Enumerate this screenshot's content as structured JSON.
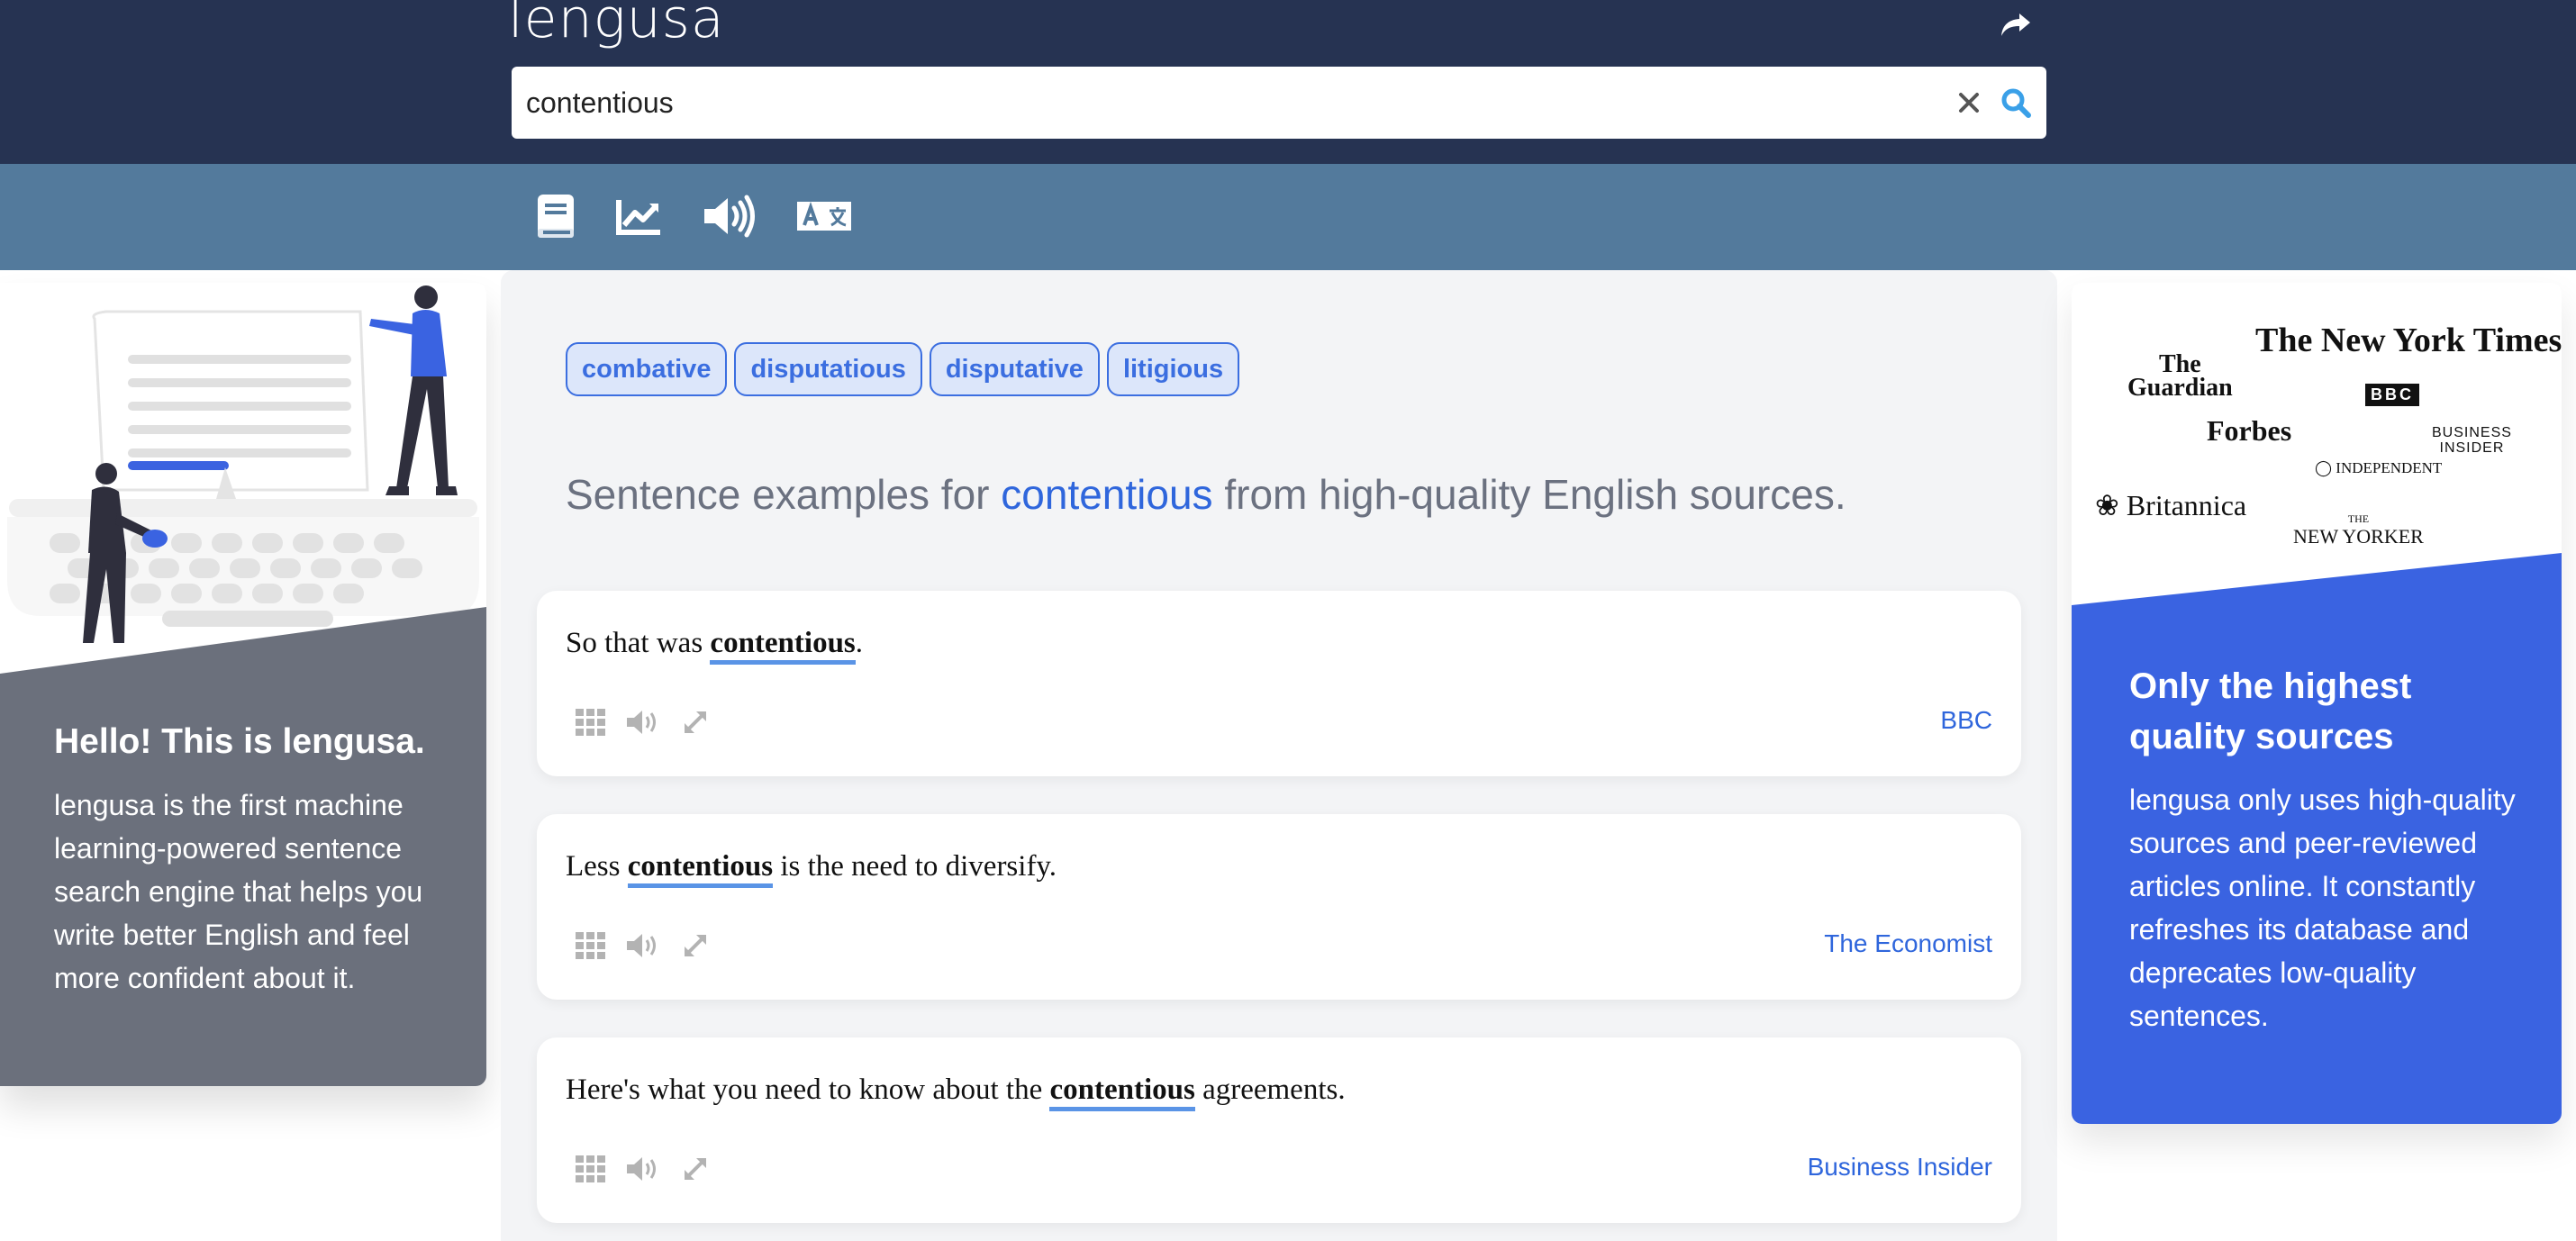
{
  "header": {
    "logo": "lengusa",
    "search": {
      "value": "contentious"
    }
  },
  "toolbar": {
    "items": [
      {
        "name": "book-icon"
      },
      {
        "name": "trend-chart-icon"
      },
      {
        "name": "speaker-icon"
      },
      {
        "name": "translate-icon"
      }
    ]
  },
  "left_card": {
    "title": "Hello! This is lengusa.",
    "text": "lengusa is the first machine learning-powered sentence search engine that helps you write better English and feel more confident about it."
  },
  "main": {
    "synonyms": [
      "combative",
      "disputatious",
      "disputative",
      "litigious"
    ],
    "heading": {
      "prefix": "Sentence examples for ",
      "keyword": "contentious",
      "suffix": " from high-quality English sources."
    },
    "sentences": [
      {
        "before": "So that was ",
        "keyword": "contentious",
        "after": ".",
        "source": "BBC"
      },
      {
        "before": "Less ",
        "keyword": "contentious",
        "after": " is the need to diversify.",
        "source": "The Economist"
      },
      {
        "before": "Here's what you need to know about the ",
        "keyword": "contentious",
        "after": " agreements.",
        "source": "Business Insider"
      }
    ]
  },
  "right_card": {
    "title": "Only the highest quality sources",
    "text": "lengusa only uses high-quality sources and peer-reviewed articles online. It constantly refreshes its database and deprecates low-quality sentences.",
    "publications": {
      "nyt": "The New York Times",
      "guardian_1": "The",
      "guardian_2": "Guardian",
      "bbc": "BBC",
      "forbes": "Forbes",
      "business_insider_1": "BUSINESS",
      "business_insider_2": "INSIDER",
      "independent": "INDEPENDENT",
      "britannica": "Britannica",
      "new_yorker_1": "THE",
      "new_yorker_2": "NEW YORKER"
    }
  },
  "colors": {
    "header": "#263352",
    "toolbar": "#537a9c",
    "accent": "#2f66dc",
    "right_card": "#3a63e1",
    "left_card": "#6b707c"
  }
}
